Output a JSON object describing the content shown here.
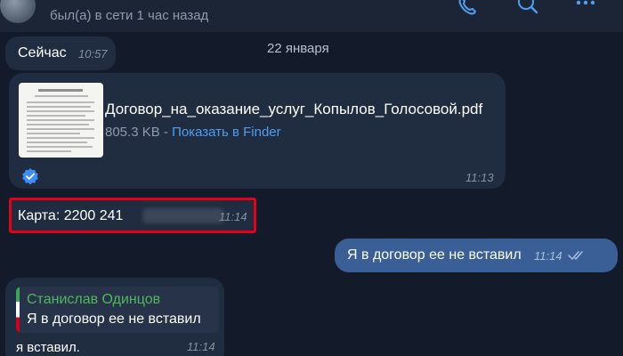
{
  "header": {
    "status": "был(а) в сети 1 час назад",
    "icons": [
      "call-icon",
      "search-icon",
      "more-icon"
    ]
  },
  "date_separator": "22 января",
  "messages": [
    {
      "kind": "incoming",
      "text": "Сейчас",
      "time": "10:57"
    },
    {
      "kind": "incoming-file",
      "file_name": "Договор_на_оказание_услуг_Копылов_Голосовой.pdf",
      "file_size": "805.3 KB",
      "separator": " - ",
      "action": "Показать в Finder",
      "time": "11:13"
    },
    {
      "kind": "incoming",
      "text": "Карта: 2200 241",
      "time": "11:14"
    },
    {
      "kind": "outgoing",
      "text": "Я в договор ее не вставил",
      "time": "11:14"
    },
    {
      "kind": "incoming-reply",
      "quote_author": "Станислав Одинцов",
      "quote_text": "Я в договор ее не вставил",
      "text": "я вставил.",
      "time": "11:14"
    }
  ],
  "colors": {
    "background": "#131b2b",
    "incoming_bubble": "#202c3f",
    "outgoing_bubble": "#3a5f96",
    "link": "#4d9ff1",
    "quote_author": "#4fb85a",
    "highlight": "#e8001a"
  }
}
